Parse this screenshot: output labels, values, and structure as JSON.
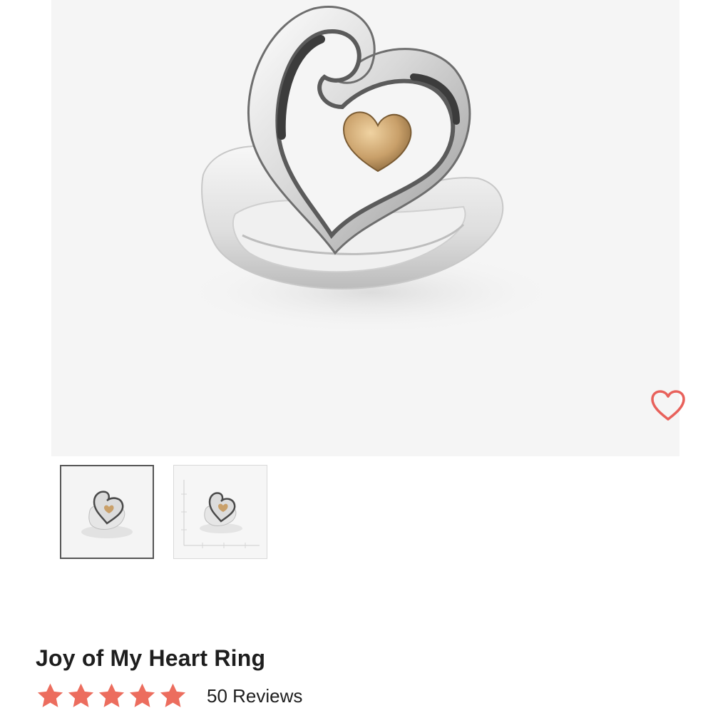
{
  "product": {
    "title": "Joy of My Heart Ring",
    "rating": 5,
    "rating_max": 5,
    "reviews_label": "50 Reviews"
  },
  "gallery": {
    "thumbnails": [
      {
        "name": "ring-front-view",
        "selected": true
      },
      {
        "name": "ring-size-chart-view",
        "selected": false
      }
    ]
  },
  "icons": {
    "favorite": "heart-outline-icon",
    "star": "star-icon"
  },
  "colors": {
    "accent": "#e8615b",
    "star": "#ec6d5e",
    "text": "#1e1e1e",
    "image_bg": "#f5f5f5",
    "silver": "#d8d8d8",
    "gold": "#c9a36b"
  }
}
